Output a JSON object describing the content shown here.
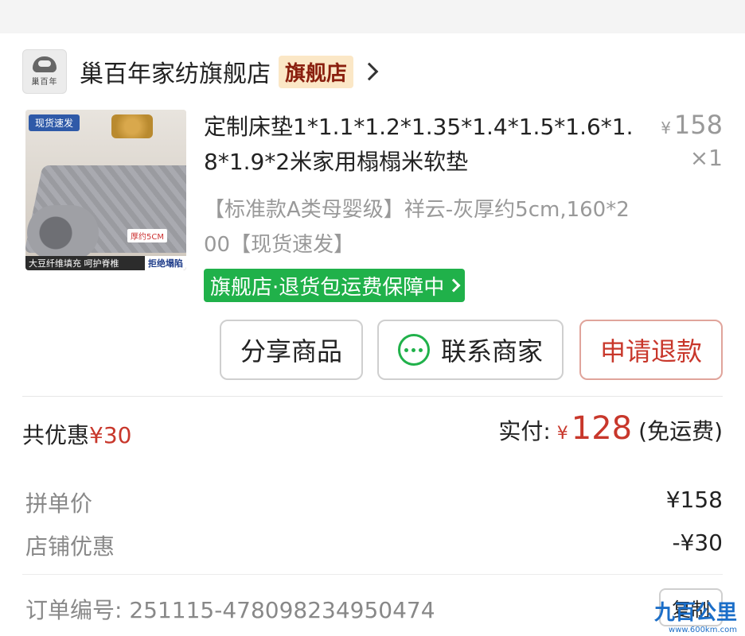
{
  "store": {
    "logo_text": "巢百年",
    "name": "巢百年家纺旗舰店",
    "badge": "旗舰店"
  },
  "product": {
    "image": {
      "fast_tag": "现货速发",
      "thickness_tag": "厚约5CM",
      "caption_left": "大豆纤维填充 呵护脊椎",
      "caption_right": "拒绝塌陷"
    },
    "title": "定制床垫1*1.1*1.2*1.35*1.4*1.5*1.6*1.8*1.9*2米家用榻榻米软垫",
    "price_symbol": "¥",
    "price": "158",
    "quantity": "×1",
    "spec": "【标准款A类母婴级】祥云-灰厚约5cm,160*200【现货速发】",
    "guarantee": "旗舰店·退货包运费保障中"
  },
  "actions": {
    "share": "分享商品",
    "contact": "联系商家",
    "refund": "申请退款"
  },
  "summary": {
    "discount_label": "共优惠",
    "discount_amount": "¥30",
    "paid_label": "实付:",
    "paid_symbol": "¥",
    "paid_amount": "128",
    "paid_note": "(免运费)"
  },
  "details": {
    "group_price_label": "拼单价",
    "group_price_value": "¥158",
    "store_discount_label": "店铺优惠",
    "store_discount_value": "-¥30",
    "order_no_label": "订单编号:",
    "order_no_value": "251115-478098234950474",
    "copy_label": "复制"
  },
  "watermark": {
    "text": "九百公里",
    "url": "www.600km.com"
  },
  "colors": {
    "accent_red": "#c8372b",
    "guarantee_green": "#20b14a",
    "badge_bg": "#fbe7c6"
  }
}
